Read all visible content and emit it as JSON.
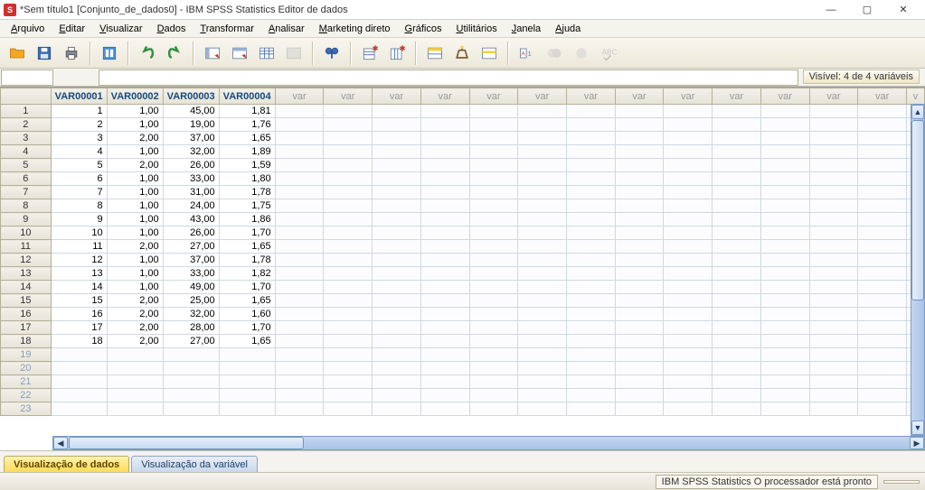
{
  "window": {
    "title": "*Sem título1 [Conjunto_de_dados0] - IBM SPSS Statistics Editor de dados",
    "min_label": "—",
    "max_label": "▢",
    "close_label": "✕"
  },
  "menu": {
    "arquivo": "Arquivo",
    "editar": "Editar",
    "visualizar": "Visualizar",
    "dados": "Dados",
    "transformar": "Transformar",
    "analisar": "Analisar",
    "marketing": "Marketing direto",
    "graficos": "Gráficos",
    "utilitarios": "Utilitários",
    "janela": "Janela",
    "ajuda": "Ajuda"
  },
  "badges": {
    "visible": "Visível: 4 de 4 variáveis"
  },
  "columns": {
    "var1": "VAR00001",
    "var2": "VAR00002",
    "var3": "VAR00003",
    "var4": "VAR00004",
    "empty": "var"
  },
  "data_rows": [
    {
      "n": "1",
      "v1": "1",
      "v2": "1,00",
      "v3": "45,00",
      "v4": "1,81"
    },
    {
      "n": "2",
      "v1": "2",
      "v2": "1,00",
      "v3": "19,00",
      "v4": "1,76"
    },
    {
      "n": "3",
      "v1": "3",
      "v2": "2,00",
      "v3": "37,00",
      "v4": "1,65"
    },
    {
      "n": "4",
      "v1": "4",
      "v2": "1,00",
      "v3": "32,00",
      "v4": "1,89"
    },
    {
      "n": "5",
      "v1": "5",
      "v2": "2,00",
      "v3": "26,00",
      "v4": "1,59"
    },
    {
      "n": "6",
      "v1": "6",
      "v2": "1,00",
      "v3": "33,00",
      "v4": "1,80"
    },
    {
      "n": "7",
      "v1": "7",
      "v2": "1,00",
      "v3": "31,00",
      "v4": "1,78"
    },
    {
      "n": "8",
      "v1": "8",
      "v2": "1,00",
      "v3": "24,00",
      "v4": "1,75"
    },
    {
      "n": "9",
      "v1": "9",
      "v2": "1,00",
      "v3": "43,00",
      "v4": "1,86"
    },
    {
      "n": "10",
      "v1": "10",
      "v2": "1,00",
      "v3": "26,00",
      "v4": "1,70"
    },
    {
      "n": "11",
      "v1": "11",
      "v2": "2,00",
      "v3": "27,00",
      "v4": "1,65"
    },
    {
      "n": "12",
      "v1": "12",
      "v2": "1,00",
      "v3": "37,00",
      "v4": "1,78"
    },
    {
      "n": "13",
      "v1": "13",
      "v2": "1,00",
      "v3": "33,00",
      "v4": "1,82"
    },
    {
      "n": "14",
      "v1": "14",
      "v2": "1,00",
      "v3": "49,00",
      "v4": "1,70"
    },
    {
      "n": "15",
      "v1": "15",
      "v2": "2,00",
      "v3": "25,00",
      "v4": "1,65"
    },
    {
      "n": "16",
      "v1": "16",
      "v2": "2,00",
      "v3": "32,00",
      "v4": "1,60"
    },
    {
      "n": "17",
      "v1": "17",
      "v2": "2,00",
      "v3": "28,00",
      "v4": "1,70"
    },
    {
      "n": "18",
      "v1": "18",
      "v2": "2,00",
      "v3": "27,00",
      "v4": "1,65"
    }
  ],
  "empty_rows": [
    "19",
    "20",
    "21",
    "22",
    "23"
  ],
  "tabs": {
    "data_view": "Visualização de dados",
    "variable_view": "Visualização da variável"
  },
  "status": {
    "processor": "IBM SPSS Statistics O processador está pronto"
  },
  "toolbar_icons": [
    {
      "name": "open-icon",
      "title": "Open"
    },
    {
      "name": "save-icon",
      "title": "Save"
    },
    {
      "name": "print-icon",
      "title": "Print"
    },
    {
      "name": "recall-icon",
      "title": "Recall"
    },
    {
      "name": "undo-icon",
      "title": "Undo"
    },
    {
      "name": "redo-icon",
      "title": "Redo"
    },
    {
      "name": "goto-var-icon",
      "title": "Variables"
    },
    {
      "name": "goto-case-icon",
      "title": "Go to case"
    },
    {
      "name": "variables-icon",
      "title": "Variables"
    },
    {
      "name": "run-icon",
      "title": "Run"
    },
    {
      "name": "find-icon",
      "title": "Find"
    },
    {
      "name": "insert-case-icon",
      "title": "Insert case"
    },
    {
      "name": "insert-var-icon",
      "title": "Insert variable"
    },
    {
      "name": "split-icon",
      "title": "Split file"
    },
    {
      "name": "weight-icon",
      "title": "Weight cases"
    },
    {
      "name": "select-cases-icon",
      "title": "Select cases"
    },
    {
      "name": "value-labels-icon",
      "title": "Value labels"
    },
    {
      "name": "use-sets-icon",
      "title": "Use sets"
    },
    {
      "name": "show-all-icon",
      "title": "Show all"
    },
    {
      "name": "spellcheck-icon",
      "title": "Spell check"
    }
  ]
}
